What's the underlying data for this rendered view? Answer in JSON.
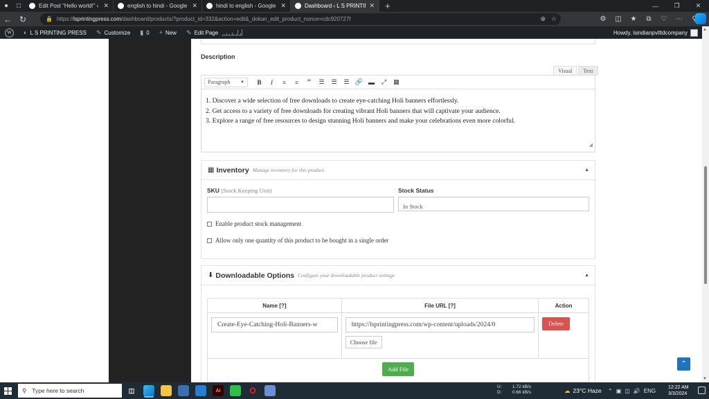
{
  "browser": {
    "tabs": [
      {
        "title": "Edit Post “Hello world!” ‹ L S PRI",
        "active": false
      },
      {
        "title": "english to hindi - Google Search",
        "active": false
      },
      {
        "title": "hindi to english - Google Search",
        "active": false
      },
      {
        "title": "Dashboard ‹ L S PRINTING PRESS",
        "active": true
      }
    ],
    "url_prefix": "https://",
    "url_host": "lsprintingpress.com",
    "url_path": "/dashboard/products/?product_id=332&action=edit&_dokan_edit_product_nonce=cdc920727f"
  },
  "adminbar": {
    "site_name": "L S PRINTING PRESS",
    "customize": "Customize",
    "comments_count": "0",
    "new": "New",
    "edit_page": "Edit Page",
    "howdy": "Howdy, lsindianpvtltdcompany"
  },
  "editor": {
    "label": "Description",
    "tab_visual": "Visual",
    "tab_text": "Text",
    "format_select": "Paragraph",
    "lines": [
      "1. Discover a wide selection of free downloads to create eye-catching Holi banners effortlessly.",
      "2. Get access to a variety of free downloads for creating vibrant Holi banners that will captivate your audience.",
      "3. Explore a range of free resources to design stunning Holi banners and make your celebrations even more colorful."
    ]
  },
  "inventory": {
    "title": "Inventory",
    "subtitle": "Manage inventory for this product.",
    "sku_label": "SKU",
    "sku_hint": "(Stock Keeping Unit)",
    "sku_value": "",
    "stock_status_label": "Stock Status",
    "stock_status_value": "In Stock",
    "check_manage_stock": "Enable product stock management",
    "check_single_qty": "Allow only one quantity of this product to be bought in a single order"
  },
  "downloads": {
    "title": "Downloadable Options",
    "subtitle": "Configure your downloadable product settings",
    "col_name": "Name [?]",
    "col_url": "File URL [?]",
    "col_action": "Action",
    "row_name": "Create-Eye-Catching-Holi-Banners-w",
    "row_url": "https://lsprintingpress.com/wp-content/uploads/2024/0",
    "choose_file": "Choose file",
    "delete": "Delete",
    "add_file": "Add File"
  },
  "taskbar": {
    "search_placeholder": "Type here to search",
    "net_up_label": "U:",
    "net_up": "1.72 kB/s",
    "net_down_label": "D:",
    "net_down": "0.66 kB/s",
    "weather": "23°C  Haze",
    "lang": "ENG",
    "time": "12:22 AM",
    "date": "3/3/2024"
  },
  "colors": {
    "admin_bar": "#1d2327",
    "delete_button": "#d9534f",
    "add_button": "#4cae4c",
    "scroll_top_button": "#1e73be"
  }
}
